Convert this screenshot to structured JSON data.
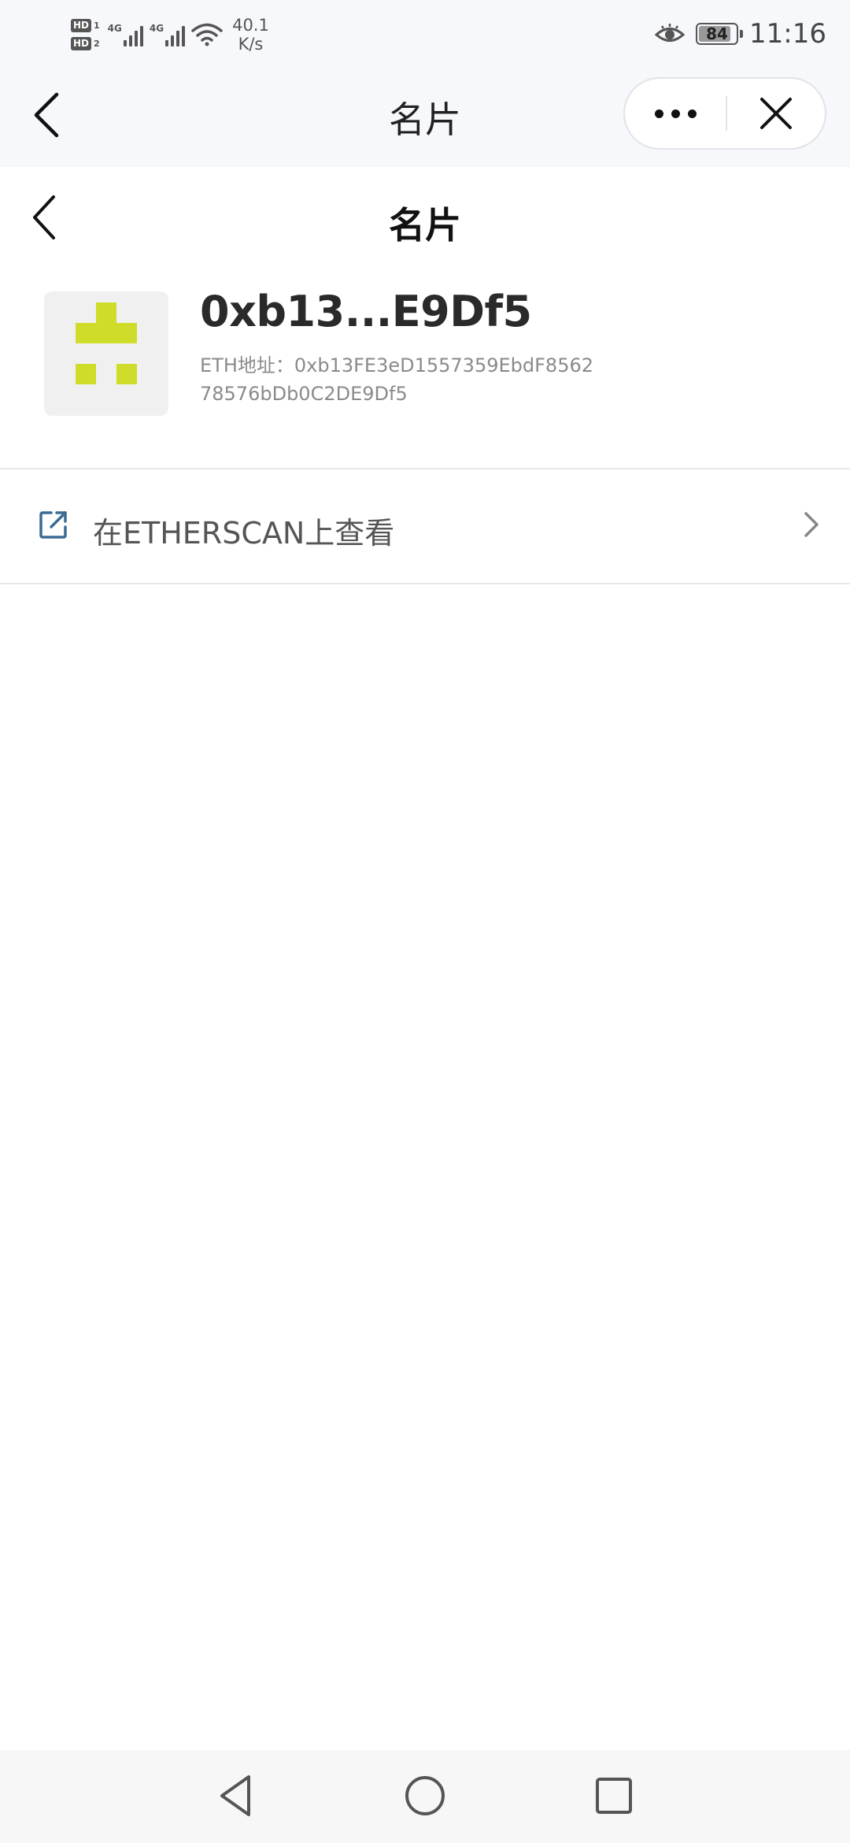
{
  "status_bar": {
    "sim1": "HD",
    "sim1_index": "1",
    "sim2": "HD",
    "sim2_index": "2",
    "network1": "4G",
    "network2": "4G",
    "speed_value": "40.1",
    "speed_unit": "K/s",
    "battery_level": "84",
    "time": "11:16"
  },
  "mp_header": {
    "title": "名片"
  },
  "page_header": {
    "title": "名片"
  },
  "profile": {
    "name": "0xb13...E9Df5",
    "address": "ETH地址：0xb13FE3eD1557359EbdF856278576bDb0C2DE9Df5",
    "avatar_color": "#cfdc2a"
  },
  "links": [
    {
      "label": "在ETHERSCAN上查看",
      "icon": "external-link-icon"
    }
  ]
}
